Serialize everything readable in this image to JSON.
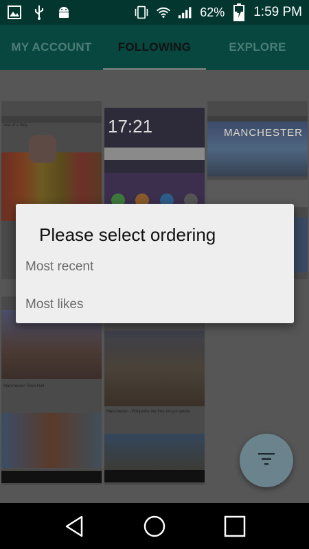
{
  "status_bar": {
    "battery_percent": "62%",
    "time": "1:59 PM",
    "icons": [
      "gallery-icon",
      "usb-icon",
      "android-icon",
      "vibrate-icon",
      "wifi-icon",
      "signal-icon",
      "battery-charging-icon"
    ]
  },
  "tabs": [
    {
      "label": "MY ACCOUNT",
      "active": false
    },
    {
      "label": "FOLLOWING",
      "active": true
    },
    {
      "label": "EXPLORE",
      "active": false
    }
  ],
  "feed": {
    "cards": [
      {
        "caption": "Vue of a time"
      },
      {
        "caption": "17:21"
      },
      {
        "caption": "MANCHESTER"
      },
      {
        "caption": "Manchester Town Hall"
      },
      {
        "caption": "Manchester - Wikipedia the free encyclopedia"
      }
    ]
  },
  "dialog": {
    "title": "Please select ordering",
    "options": [
      "Most recent",
      "Most likes"
    ]
  },
  "fab": {
    "icon": "filter-icon"
  },
  "nav_bar": {
    "icons": [
      "back-icon",
      "home-icon",
      "recents-icon"
    ]
  },
  "colors": {
    "status_bar": "#02362f",
    "app_bar": "#07473f",
    "scrim": "#565656",
    "dialog_bg": "#eeeeee",
    "fab": "#6b838d"
  }
}
